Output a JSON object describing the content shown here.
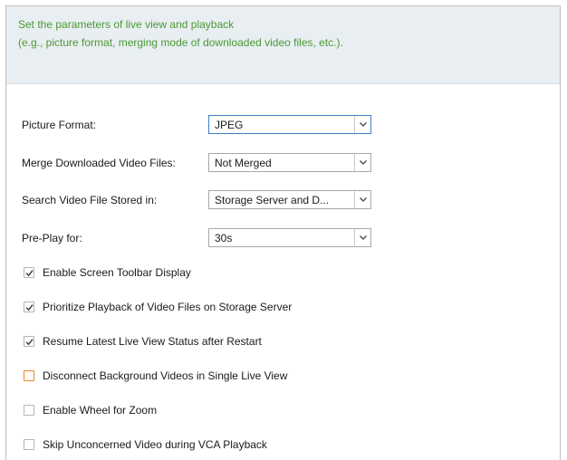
{
  "header": {
    "line1": "Set the parameters of live view and playback",
    "line2": "(e.g., picture format, merging mode of downloaded video files, etc.)."
  },
  "fields": [
    {
      "label": "Picture Format:",
      "value": "JPEG"
    },
    {
      "label": "Merge Downloaded Video Files:",
      "value": "Not Merged"
    },
    {
      "label": "Search Video File Stored in:",
      "value": "Storage Server and D..."
    },
    {
      "label": "Pre-Play for:",
      "value": "30s"
    }
  ],
  "options": [
    {
      "label": "Enable Screen Toolbar Display",
      "checked": true
    },
    {
      "label": "Prioritize Playback of Video Files on Storage Server",
      "checked": true
    },
    {
      "label": "Resume Latest Live View Status after Restart",
      "checked": true
    },
    {
      "label": "Disconnect Background Videos in Single Live View",
      "checked": false
    },
    {
      "label": "Enable Wheel for Zoom",
      "checked": false
    },
    {
      "label": "Skip Unconcerned Video during VCA Playback",
      "checked": false
    }
  ],
  "colors": {
    "header_text": "#4a9a33",
    "header_bg": "#e9eef2",
    "focus_border": "#3f7fc4",
    "highlight_border": "#e08a2c",
    "check_mark": "#444444"
  }
}
